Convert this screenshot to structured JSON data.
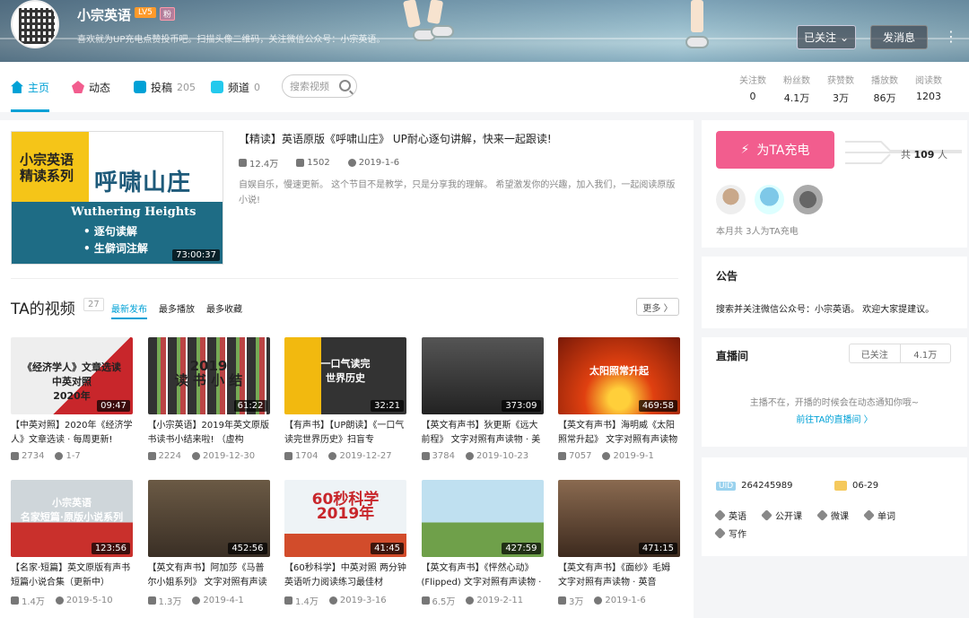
{
  "header": {
    "username": "小宗英语",
    "level": "LV5",
    "badge": "粉",
    "sign": "喜欢就为UP充电点赞投币吧。扫描头像二维码，关注微信公众号：小宗英语。",
    "follow_label": "已关注",
    "message_label": "发消息",
    "more_label": "⋮"
  },
  "nav": {
    "tabs": [
      {
        "label": "主页",
        "count": ""
      },
      {
        "label": "动态",
        "count": ""
      },
      {
        "label": "投稿",
        "count": "205"
      },
      {
        "label": "频道",
        "count": "0"
      }
    ],
    "search_placeholder": "搜索视频",
    "stats": [
      {
        "label": "关注数",
        "value": "0"
      },
      {
        "label": "粉丝数",
        "value": "4.1万"
      },
      {
        "label": "获赞数",
        "value": "3万"
      },
      {
        "label": "播放数",
        "value": "86万"
      },
      {
        "label": "阅读数",
        "value": "1203"
      }
    ]
  },
  "featured": {
    "title": "【精读】英语原版《呼啸山庄》 UP耐心逐句讲解，快来一起跟读!",
    "plays": "12.4万",
    "danmaku": "1502",
    "date": "2019-1-6",
    "desc": "自娱自乐，慢速更新。 这个节目不是教学，只是分享我的理解。 希望激发你的兴趣，加入我们，一起阅读原版小说!",
    "thumb_line1": "小宗英语",
    "thumb_line2": "精读系列",
    "thumb_main": "呼啸山庄",
    "thumb_en": "Wuthering Heights",
    "thumb_b1": "• 逐句读解",
    "thumb_b2": "• 生僻词注解",
    "duration": "73:00:37"
  },
  "videos_section": {
    "title": "TA的视频",
    "count": "27",
    "sorts": [
      "最新发布",
      "最多播放",
      "最多收藏"
    ],
    "more_label": "更多 〉"
  },
  "videos": [
    {
      "title": "【中英对照】2020年《经济学人》文章选读 · 每周更新!",
      "plays": "2734",
      "date": "1-7",
      "duration": "09:47",
      "cap": "《经济学人》文章选读\n中英对照\n2020年"
    },
    {
      "title": "【小宗英语】2019年英文原版书读书小结来啦! （虚构",
      "plays": "2224",
      "date": "2019-12-30",
      "duration": "61:22",
      "cap": "2019\n读 书 小 结"
    },
    {
      "title": "【有声书】【UP朗读】《一口气读完世界历史》扫盲专",
      "plays": "1704",
      "date": "2019-12-27",
      "duration": "32:21",
      "cap": "一口气读完\n世界历史"
    },
    {
      "title": "【英文有声书】狄更斯《远大前程》 文字对照有声读物 · 美",
      "plays": "3784",
      "date": "2019-10-23",
      "duration": "373:09",
      "cap": ""
    },
    {
      "title": "【英文有声书】海明威《太阳照常升起》 文字对照有声读物",
      "plays": "7057",
      "date": "2019-9-1",
      "duration": "469:58",
      "cap": "太阳照常升起"
    },
    {
      "title": "【名家·短篇】英文原版有声书短篇小说合集（更新中）",
      "plays": "1.4万",
      "date": "2019-5-10",
      "duration": "123:56",
      "cap": "小宗英语\n名家短篇·原版小说系列"
    },
    {
      "title": "【英文有声书】阿加莎《马普尔小姐系列》 文字对照有声读",
      "plays": "1.3万",
      "date": "2019-4-1",
      "duration": "452:56",
      "cap": ""
    },
    {
      "title": "【60秒科学】中英对照 两分钟英语听力阅读练习最佳材",
      "plays": "1.4万",
      "date": "2019-3-16",
      "duration": "41:45",
      "cap": "60秒科学\n2019年"
    },
    {
      "title": "【英文有声书】《怦然心动》(Flipped) 文字对照有声读物 ·",
      "plays": "6.5万",
      "date": "2019-2-11",
      "duration": "427:59",
      "cap": ""
    },
    {
      "title": "【英文有声书】《面纱》毛姆 文字对照有声读物 · 英音",
      "plays": "3万",
      "date": "2019-1-6",
      "duration": "471:15",
      "cap": ""
    }
  ],
  "charge": {
    "button_label": "为TA充电",
    "total_prefix": "共",
    "total_value": "109",
    "total_suffix": "人",
    "month_text": "本月共 3人为TA充电"
  },
  "notice": {
    "title": "公告",
    "text": "搜索并关注微信公众号：小宗英语。 欢迎大家提建议。"
  },
  "live": {
    "title": "直播间",
    "follow_label": "已关注",
    "follow_count": "4.1万",
    "offline_text": "主播不在，开播的时候会在动态通知你哦~",
    "link_text": "前往TA的直播间 〉"
  },
  "profile": {
    "uid_label": "UID",
    "uid": "264245989",
    "birthday": "06-29",
    "tags": [
      "英语",
      "公开课",
      "微课",
      "单词",
      "写作"
    ]
  },
  "colors": {
    "accent": "#00a1d6",
    "charge": "#f25d8e"
  }
}
